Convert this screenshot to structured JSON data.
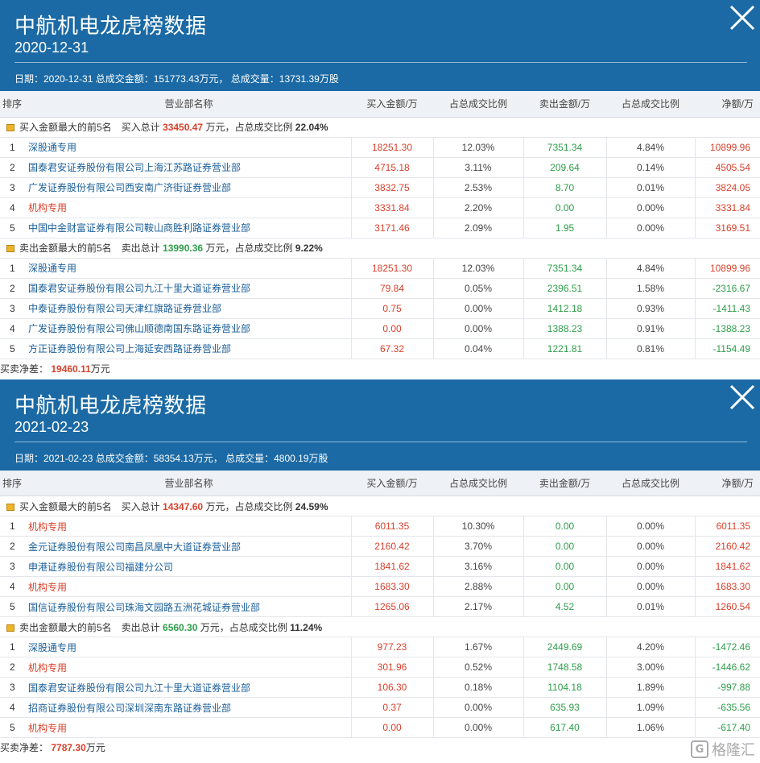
{
  "headers": [
    "排序",
    "营业部名称",
    "买入金额/万",
    "占总成交比例",
    "卖出金额/万",
    "占总成交比例",
    "净额/万"
  ],
  "panels": [
    {
      "title": "中航机电龙虎榜数据",
      "date": "2020-12-31",
      "summary": "日期：2020-12-31 总成交金额：151773.43万元， 总成交量：13731.39万股",
      "buy_section": {
        "prefix": "买入金额最大的前5名　买入总计",
        "total": "33450.47",
        "mid": "万元，占总成交比例",
        "pct": "22.04%"
      },
      "buy_rows": [
        {
          "rank": "1",
          "name": "深股通专用",
          "buy": "18251.30",
          "buy_pct": "12.03%",
          "sell": "7351.34",
          "sell_pct": "4.84%",
          "net": "10899.96",
          "name_red": false,
          "net_sign": "pos"
        },
        {
          "rank": "2",
          "name": "国泰君安证券股份有限公司上海江苏路证券营业部",
          "buy": "4715.18",
          "buy_pct": "3.11%",
          "sell": "209.64",
          "sell_pct": "0.14%",
          "net": "4505.54",
          "name_red": false,
          "net_sign": "pos"
        },
        {
          "rank": "3",
          "name": "广发证券股份有限公司西安南广济街证券营业部",
          "buy": "3832.75",
          "buy_pct": "2.53%",
          "sell": "8.70",
          "sell_pct": "0.01%",
          "net": "3824.05",
          "name_red": false,
          "net_sign": "pos"
        },
        {
          "rank": "4",
          "name": "机构专用",
          "buy": "3331.84",
          "buy_pct": "2.20%",
          "sell": "0.00",
          "sell_pct": "0.00%",
          "net": "3331.84",
          "name_red": true,
          "net_sign": "pos"
        },
        {
          "rank": "5",
          "name": "中国中金财富证券有限公司鞍山商胜利路证券营业部",
          "buy": "3171.46",
          "buy_pct": "2.09%",
          "sell": "1.95",
          "sell_pct": "0.00%",
          "net": "3169.51",
          "name_red": false,
          "net_sign": "pos"
        }
      ],
      "sell_section": {
        "prefix": "卖出金额最大的前5名　卖出总计",
        "total": "13990.36",
        "mid": "万元，占总成交比例",
        "pct": "9.22%"
      },
      "sell_rows": [
        {
          "rank": "1",
          "name": "深股通专用",
          "buy": "18251.30",
          "buy_pct": "12.03%",
          "sell": "7351.34",
          "sell_pct": "4.84%",
          "net": "10899.96",
          "name_red": false,
          "net_sign": "pos"
        },
        {
          "rank": "2",
          "name": "国泰君安证券股份有限公司九江十里大道证券营业部",
          "buy": "79.84",
          "buy_pct": "0.05%",
          "sell": "2396.51",
          "sell_pct": "1.58%",
          "net": "-2316.67",
          "name_red": false,
          "net_sign": "neg"
        },
        {
          "rank": "3",
          "name": "中泰证券股份有限公司天津红旗路证券营业部",
          "buy": "0.75",
          "buy_pct": "0.00%",
          "sell": "1412.18",
          "sell_pct": "0.93%",
          "net": "-1411.43",
          "name_red": false,
          "net_sign": "neg"
        },
        {
          "rank": "4",
          "name": "广发证券股份有限公司佛山顺德南国东路证券营业部",
          "buy": "0.00",
          "buy_pct": "0.00%",
          "sell": "1388.23",
          "sell_pct": "0.91%",
          "net": "-1388.23",
          "name_red": false,
          "net_sign": "neg"
        },
        {
          "rank": "5",
          "name": "方正证券股份有限公司上海延安西路证券营业部",
          "buy": "67.32",
          "buy_pct": "0.04%",
          "sell": "1221.81",
          "sell_pct": "0.81%",
          "net": "-1154.49",
          "name_red": false,
          "net_sign": "neg"
        }
      ],
      "footer": {
        "label": "买卖净差：",
        "value": "19460.11",
        "unit": "万元"
      }
    },
    {
      "title": "中航机电龙虎榜数据",
      "date": "2021-02-23",
      "summary": "日期：2021-02-23 总成交金额：58354.13万元， 总成交量：4800.19万股",
      "buy_section": {
        "prefix": "买入金额最大的前5名　买入总计",
        "total": "14347.60",
        "mid": "万元，占总成交比例",
        "pct": "24.59%"
      },
      "buy_rows": [
        {
          "rank": "1",
          "name": "机构专用",
          "buy": "6011.35",
          "buy_pct": "10.30%",
          "sell": "0.00",
          "sell_pct": "0.00%",
          "net": "6011.35",
          "name_red": true,
          "net_sign": "pos"
        },
        {
          "rank": "2",
          "name": "金元证券股份有限公司南昌凤凰中大道证券营业部",
          "buy": "2160.42",
          "buy_pct": "3.70%",
          "sell": "0.00",
          "sell_pct": "0.00%",
          "net": "2160.42",
          "name_red": false,
          "net_sign": "pos"
        },
        {
          "rank": "3",
          "name": "申港证券股份有限公司福建分公司",
          "buy": "1841.62",
          "buy_pct": "3.16%",
          "sell": "0.00",
          "sell_pct": "0.00%",
          "net": "1841.62",
          "name_red": false,
          "net_sign": "pos"
        },
        {
          "rank": "4",
          "name": "机构专用",
          "buy": "1683.30",
          "buy_pct": "2.88%",
          "sell": "0.00",
          "sell_pct": "0.00%",
          "net": "1683.30",
          "name_red": true,
          "net_sign": "pos"
        },
        {
          "rank": "5",
          "name": "国信证券股份有限公司珠海文园路五洲花城证券营业部",
          "buy": "1265.06",
          "buy_pct": "2.17%",
          "sell": "4.52",
          "sell_pct": "0.01%",
          "net": "1260.54",
          "name_red": false,
          "net_sign": "pos"
        }
      ],
      "sell_section": {
        "prefix": "卖出金额最大的前5名　卖出总计",
        "total": "6560.30",
        "mid": "万元，占总成交比例",
        "pct": "11.24%"
      },
      "sell_rows": [
        {
          "rank": "1",
          "name": "深股通专用",
          "buy": "977.23",
          "buy_pct": "1.67%",
          "sell": "2449.69",
          "sell_pct": "4.20%",
          "net": "-1472.46",
          "name_red": false,
          "net_sign": "neg"
        },
        {
          "rank": "2",
          "name": "机构专用",
          "buy": "301.96",
          "buy_pct": "0.52%",
          "sell": "1748.58",
          "sell_pct": "3.00%",
          "net": "-1446.62",
          "name_red": true,
          "net_sign": "neg"
        },
        {
          "rank": "3",
          "name": "国泰君安证券股份有限公司九江十里大道证券营业部",
          "buy": "106.30",
          "buy_pct": "0.18%",
          "sell": "1104.18",
          "sell_pct": "1.89%",
          "net": "-997.88",
          "name_red": false,
          "net_sign": "neg"
        },
        {
          "rank": "4",
          "name": "招商证券股份有限公司深圳深南东路证券营业部",
          "buy": "0.37",
          "buy_pct": "0.00%",
          "sell": "635.93",
          "sell_pct": "1.09%",
          "net": "-635.56",
          "name_red": false,
          "net_sign": "neg"
        },
        {
          "rank": "5",
          "name": "机构专用",
          "buy": "0.00",
          "buy_pct": "0.00%",
          "sell": "617.40",
          "sell_pct": "1.06%",
          "net": "-617.40",
          "name_red": true,
          "net_sign": "neg"
        }
      ],
      "footer": {
        "label": "买卖净差：",
        "value": "7787.30",
        "unit": "万元"
      }
    }
  ],
  "watermark": {
    "logo": "G",
    "text": "格隆汇"
  },
  "colors": {
    "header_bg": "#1b6aa5",
    "buy_red": "#d9412b",
    "sell_green": "#2e9e4a",
    "link_blue": "#1b5f99"
  }
}
